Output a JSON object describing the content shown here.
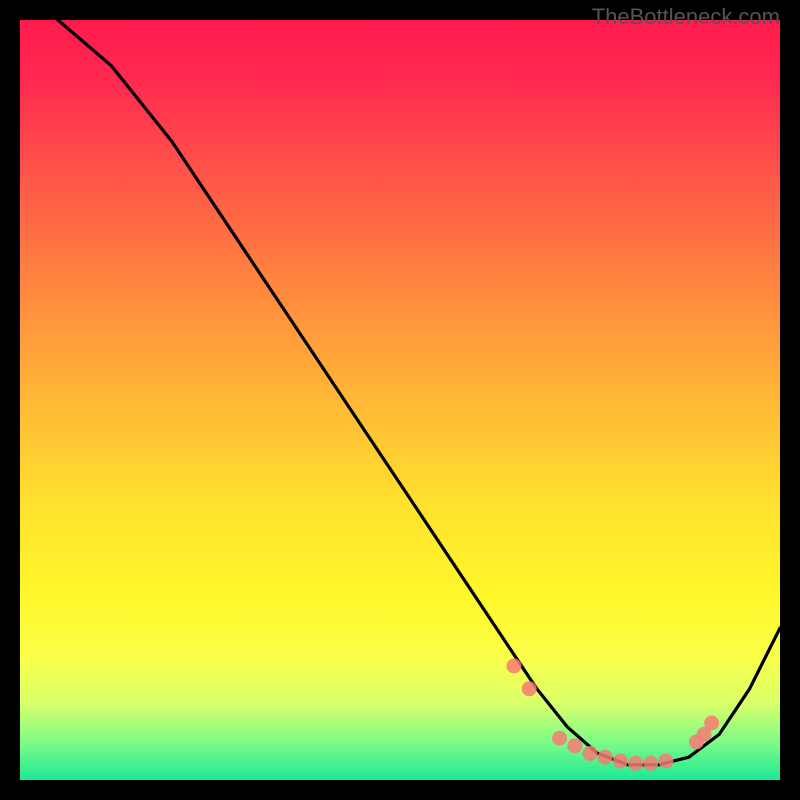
{
  "watermark": "TheBottleneck.com",
  "chart_data": {
    "type": "line",
    "title": "",
    "xlabel": "",
    "ylabel": "",
    "xlim": [
      0,
      100
    ],
    "ylim": [
      0,
      100
    ],
    "series": [
      {
        "name": "bottleneck-curve",
        "x": [
          0,
          5,
          12,
          20,
          28,
          36,
          44,
          52,
          58,
          64,
          68,
          72,
          76,
          80,
          84,
          88,
          92,
          96,
          100
        ],
        "y": [
          108,
          100,
          94,
          84,
          72,
          60,
          48,
          36,
          27,
          18,
          12,
          7,
          3.5,
          2,
          2,
          3,
          6,
          12,
          20
        ]
      }
    ],
    "markers": {
      "name": "highlight-dots",
      "x": [
        65,
        67,
        71,
        73,
        75,
        77,
        79,
        81,
        83,
        85,
        89,
        90,
        91
      ],
      "y": [
        15,
        12,
        5.5,
        4.5,
        3.5,
        3,
        2.5,
        2.2,
        2.2,
        2.5,
        5,
        6,
        7.5
      ]
    },
    "gradient_stops": [
      {
        "pos": 0,
        "color": "#ff1a4d"
      },
      {
        "pos": 8,
        "color": "#ff2a50"
      },
      {
        "pos": 22,
        "color": "#ff5a47"
      },
      {
        "pos": 36,
        "color": "#ff8a3e"
      },
      {
        "pos": 50,
        "color": "#ffb836"
      },
      {
        "pos": 64,
        "color": "#ffe22e"
      },
      {
        "pos": 76,
        "color": "#fff82a"
      },
      {
        "pos": 84,
        "color": "#faff4a"
      },
      {
        "pos": 90,
        "color": "#d8ff6a"
      },
      {
        "pos": 95,
        "color": "#7dfc86"
      },
      {
        "pos": 100,
        "color": "#1de896"
      }
    ]
  }
}
